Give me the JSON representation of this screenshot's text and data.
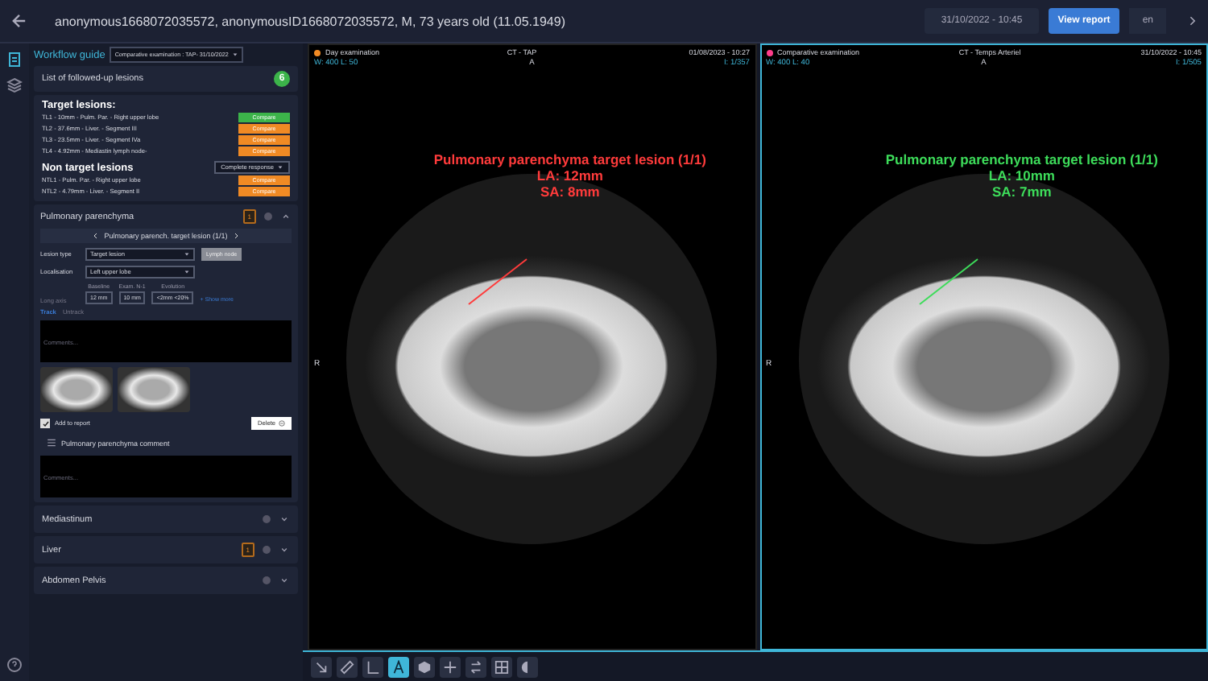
{
  "header": {
    "patient": "anonymous1668072035572, anonymousID1668072035572, M, 73 years old (11.05.1949)",
    "exam_date": "31/10/2022 - 10:45",
    "view_report": "View report",
    "language": "en"
  },
  "sidebar": {
    "tab": "Workflow guide",
    "comparative": "Comparative examination : TAP- 31/10/2022",
    "lesions_title": "List of followed-up lesions",
    "lesions_count": "6",
    "target_title": "Target lesions:",
    "targets": [
      {
        "label": "TL1 - 10mm - Pulm. Par. - Right upper lobe",
        "button": "Compare",
        "selected": true
      },
      {
        "label": "TL2 - 37.6mm - Liver. - Segment  III",
        "button": "Compare",
        "selected": false
      },
      {
        "label": "TL3 - 23.5mm - Liver. - Segment IVa",
        "button": "Compare",
        "selected": false
      },
      {
        "label": "TL4 - 4.92mm - Mediastin lymph node-",
        "button": "Compare",
        "selected": false
      }
    ],
    "nontarget_title": "Non target lesions",
    "nontarget_response": "Complete response",
    "nontargets": [
      {
        "label": "NTL1 - Pulm. Par. - Right upper lobe",
        "button": "Compare",
        "selected": false
      },
      {
        "label": "NTL2 - 4.79mm - Liver. - Segment II",
        "button": "Compare",
        "selected": false
      }
    ],
    "section": {
      "title": "Pulmonary parenchyma",
      "count": "1",
      "nav": "Pulmonary parench. target lesion (1/1)",
      "lesion_type_label": "Lesion type",
      "lesion_type": "Target lesion",
      "lymph_button": "Lymph node",
      "localisation_label": "Localisation",
      "localisation": "Left upper lobe",
      "axis_label": "Long axis",
      "measures": [
        {
          "head": "Baseline",
          "value": "12 mm"
        },
        {
          "head": "Exam. N-1",
          "value": "10 mm"
        },
        {
          "head": "Evolution",
          "value": "<2mm <20%"
        }
      ],
      "show_more": "+ Show more",
      "track": "Track",
      "untrack": "Untrack",
      "comments_placeholder": "Comments...",
      "add_to_report": "Add to report",
      "add_checked": true,
      "delete": "Delete",
      "comment_title": "Pulmonary parenchyma comment",
      "comment_placeholder": "Comments..."
    },
    "collapsed": [
      {
        "title": "Mediastinum"
      },
      {
        "title": "Liver",
        "count": "1"
      },
      {
        "title": "Abdomen Pelvis"
      }
    ]
  },
  "viewers": [
    {
      "exam": "Day examination",
      "color": "#f08a24",
      "series": "CT - TAP",
      "datetime": "01/08/2023 - 10:27",
      "window": "W: 400  L: 50",
      "orientation_top": "A",
      "orientation_left": "R",
      "image_index": "I: 1/357",
      "active": false,
      "annotation": {
        "title": "Pulmonary parenchyma target lesion (1/1)",
        "la": "LA: 12mm",
        "sa": "SA: 8mm",
        "color": "#ff3b3b"
      }
    },
    {
      "exam": "Comparative examination",
      "color": "#ff3d8b",
      "series": "CT - Temps Arteriel",
      "datetime": "31/10/2022 - 10:45",
      "window": "W: 400  L: 40",
      "orientation_top": "A",
      "orientation_left": "R",
      "image_index": "I: 1/505",
      "active": true,
      "annotation": {
        "title": "Pulmonary parenchyma target lesion (1/1)",
        "la": "LA: 10mm",
        "sa": "SA: 7mm",
        "color": "#3ddc5a"
      }
    }
  ],
  "toolbar": [
    {
      "kind": "arrow",
      "selected": false
    },
    {
      "kind": "ruler",
      "selected": false
    },
    {
      "kind": "angle",
      "selected": false
    },
    {
      "kind": "a",
      "selected": true
    },
    {
      "kind": "hexagon",
      "selected": false
    },
    {
      "kind": "plus",
      "selected": false
    },
    {
      "kind": "swap",
      "selected": false
    },
    {
      "kind": "grid",
      "selected": false
    },
    {
      "kind": "contrast",
      "selected": false
    }
  ]
}
